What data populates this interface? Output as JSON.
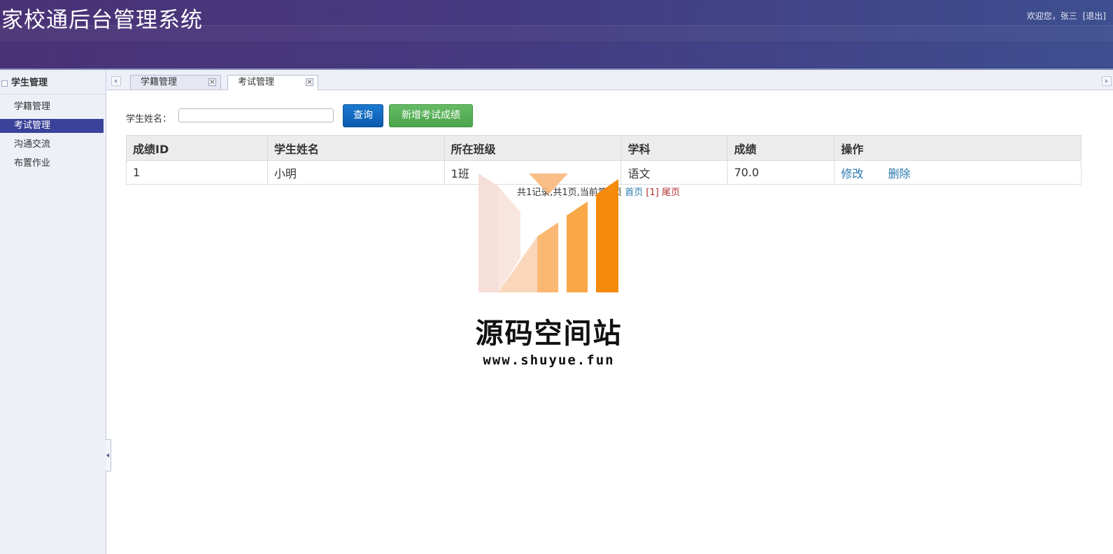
{
  "header": {
    "title": "家校通后台管理系统",
    "welcome": "欢迎您，张三",
    "logout": "[退出]"
  },
  "sidebar": {
    "group_title": "学生管理",
    "items": [
      {
        "label": "学籍管理"
      },
      {
        "label": "考试管理"
      },
      {
        "label": "沟通交流"
      },
      {
        "label": "布置作业"
      }
    ],
    "active_item": "考试管理"
  },
  "tabs": [
    {
      "label": "学籍管理",
      "close": "×"
    },
    {
      "label": "考试管理",
      "close": "×"
    }
  ],
  "active_tab": "考试管理",
  "search": {
    "label": "学生姓名：",
    "value": "",
    "query_button": "查询",
    "add_button": "新增考试成绩"
  },
  "table": {
    "headers": [
      "成绩ID",
      "学生姓名",
      "所在班级",
      "学科",
      "成绩",
      "操作"
    ],
    "rows": [
      {
        "id": "1",
        "name": "小明",
        "class": "1班",
        "subject": "语文",
        "score": "70.0",
        "edit": "修改",
        "delete": "删除"
      }
    ]
  },
  "pager": {
    "summary": "共1记录,共1页,当前第1页",
    "first": "首页",
    "current": "[1]",
    "last": "尾页"
  },
  "watermark": {
    "name": "源码空间站",
    "url": "www.shuyue.fun"
  },
  "colors": {
    "header_bg": "#453a80",
    "sidebar_active": "#3b429a",
    "query_button": "#0c5bb0",
    "add_button": "#4aa54a",
    "link": "#2a7ab0",
    "watermark_orange": "#f58a0c"
  }
}
